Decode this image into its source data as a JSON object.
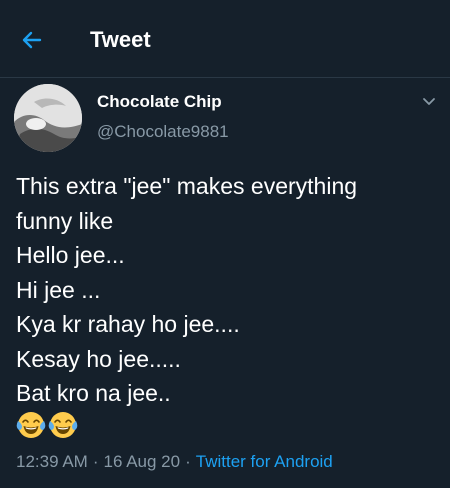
{
  "header": {
    "title": "Tweet",
    "back_icon": "arrow-left-icon"
  },
  "colors": {
    "background": "#15202b",
    "accent": "#1da1f2",
    "secondary_text": "#8899a6",
    "primary_text": "#ffffff"
  },
  "author": {
    "display_name": "Chocolate Chip",
    "handle": "@Chocolate9881",
    "menu_icon": "chevron-down-icon"
  },
  "tweet": {
    "lines": [
      "This extra \"jee\" makes everything",
      "funny like",
      "Hello jee...",
      "Hi jee ...",
      "Kya kr rahay ho jee....",
      "Kesay ho jee.....",
      "Bat kro na jee.."
    ],
    "emojis": [
      "face-with-tears-of-joy-icon",
      "face-with-tears-of-joy-icon"
    ]
  },
  "meta": {
    "time": "12:39 AM",
    "separator": "·",
    "date": "16 Aug 20",
    "source": "Twitter for Android"
  }
}
